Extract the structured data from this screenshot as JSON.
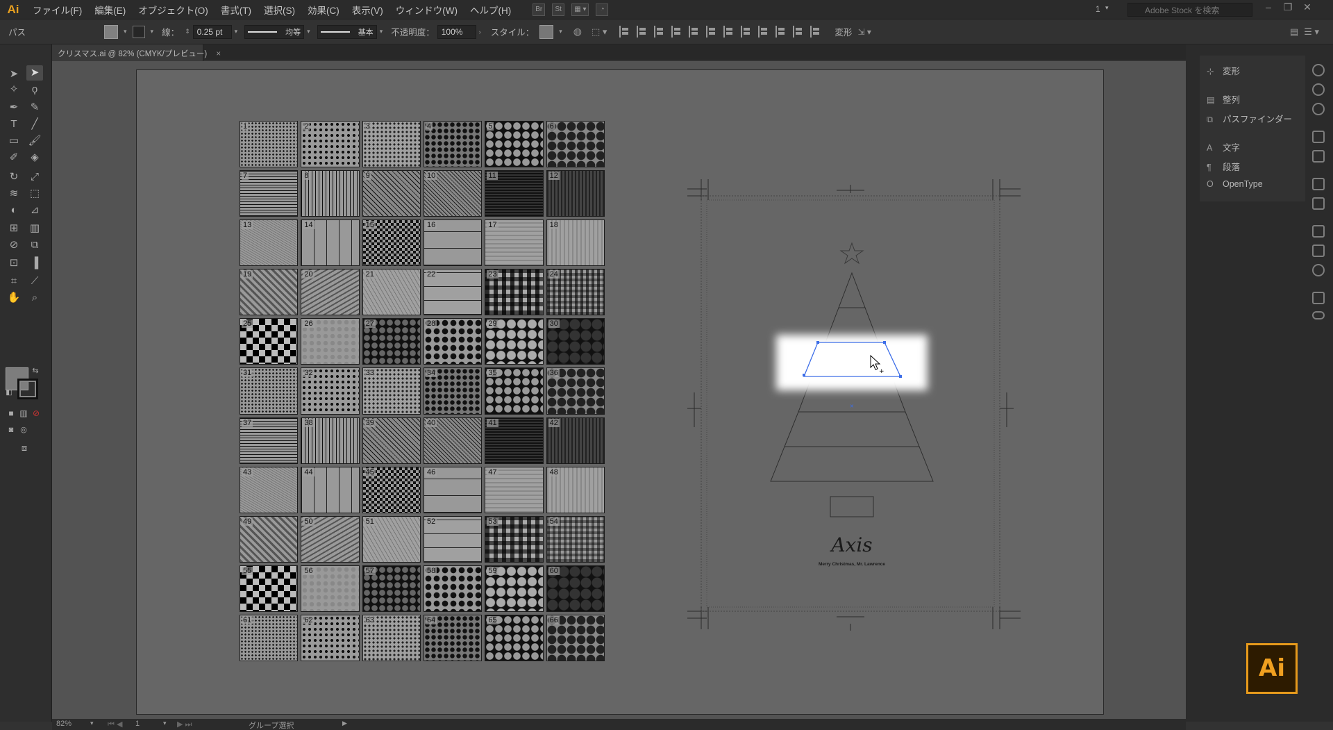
{
  "menubar": {
    "logo": "Ai",
    "items": [
      "ファイル(F)",
      "編集(E)",
      "オブジェクト(O)",
      "書式(T)",
      "選択(S)",
      "効果(C)",
      "表示(V)",
      "ウィンドウ(W)",
      "ヘルプ(H)"
    ],
    "bridge_button": "Br",
    "stock_button": "St",
    "workspace_number": "1",
    "search_placeholder": "Adobe Stock を検索"
  },
  "controlbar": {
    "selection_type": "パス",
    "stroke_label": "線：",
    "stroke_weight": "0.25 pt",
    "stroke_profile": "均等",
    "brush": "基本",
    "opacity_label": "不透明度：",
    "opacity_value": "100%",
    "style_label": "スタイル：",
    "transform_label": "変形"
  },
  "document_tab": {
    "title": "クリスマス.ai @ 82% (CMYK/プレビュー)",
    "close": "×"
  },
  "patterns": {
    "numbers": [
      "1",
      "2",
      "3",
      "4",
      "5",
      "6",
      "7",
      "8",
      "9",
      "10",
      "11",
      "12",
      "13",
      "14",
      "15",
      "16",
      "17",
      "18",
      "19",
      "20",
      "21",
      "22",
      "23",
      "24",
      "25",
      "26",
      "27",
      "28",
      "29",
      "30",
      "31",
      "32",
      "33",
      "34",
      "35",
      "36",
      "37",
      "38",
      "39",
      "40",
      "41",
      "42",
      "43",
      "44",
      "45",
      "46",
      "47",
      "48",
      "49",
      "50",
      "51",
      "52",
      "53",
      "54",
      "55",
      "56",
      "57",
      "58",
      "59",
      "60",
      "61",
      "62",
      "63",
      "64",
      "65",
      "66"
    ]
  },
  "artwork": {
    "logo_script": "Axis",
    "caption": "Merry Christmas, Mr. Lawrence"
  },
  "panels": {
    "items": [
      "変形",
      "整列",
      "パスファインダー",
      "文字",
      "段落",
      "OpenType"
    ]
  },
  "statusbar": {
    "zoom": "82%",
    "artboard_number": "1",
    "tool_status": "グループ選択"
  },
  "badge": {
    "label": "Ai",
    "color": "#e79a1c"
  },
  "colors": {
    "selection": "#3d6ee8",
    "accent": "#e8a020"
  }
}
